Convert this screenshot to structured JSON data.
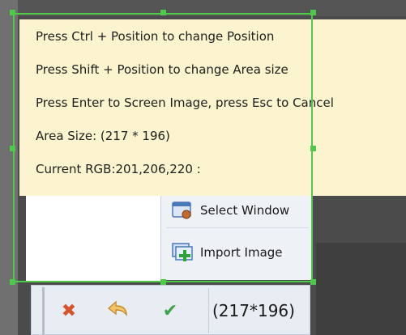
{
  "tooltip": {
    "line1": "Press Ctrl + Position to change Position",
    "line2": "Press Shift + Position to change Area size",
    "line3": "Press Enter to Screen Image, press Esc to  Cancel",
    "line4": "Area Size:  (217 * 196)",
    "line5": "Current RGB:201,206,220 :"
  },
  "menu": {
    "select_window": "Select Window",
    "import_image": "Import Image"
  },
  "toolbar": {
    "size": "(217*196)",
    "cancel_icon": "close-icon",
    "back_icon": "back-arrow-icon",
    "ok_icon": "checkmark-icon"
  },
  "colors": {
    "selection_border": "#4ec94a",
    "tooltip_bg": "#fbf4cf"
  }
}
